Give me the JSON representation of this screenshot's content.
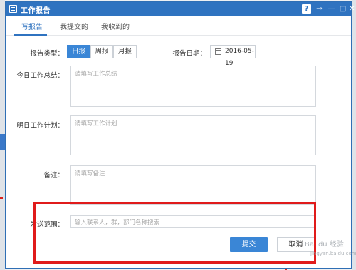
{
  "window": {
    "title": "工作报告",
    "help_label": "?",
    "pin_glyph": "⊸",
    "min_glyph": "—",
    "max_glyph": "□",
    "close_glyph": "✕"
  },
  "tabs": [
    {
      "label": "写报告",
      "active": true
    },
    {
      "label": "我提交的",
      "active": false
    },
    {
      "label": "我收到的",
      "active": false
    }
  ],
  "form": {
    "report_type_label": "报告类型：",
    "report_types": [
      "日报",
      "周报",
      "月报"
    ],
    "selected_type": "日报",
    "report_date_label": "报告日期：",
    "report_date_value": "2016-05-19",
    "today_summary_label": "今日工作总结：",
    "today_summary_placeholder": "请填写工作总结",
    "tomorrow_plan_label": "明日工作计划：",
    "tomorrow_plan_placeholder": "请填写工作计划",
    "note_label": "备注：",
    "note_placeholder": "请填写备注",
    "send_scope_label": "发送范围：",
    "send_scope_placeholder": "输入联系人，群，部门名称搜索",
    "submit_label": "提交",
    "cancel_label": "取消"
  },
  "watermark": {
    "text": "Bai du 经验",
    "sub": "jingyan.baidu.com"
  },
  "colors": {
    "titlebar": "#2f73c0",
    "accent": "#3a86d6",
    "highlight": "#e01b1b"
  }
}
